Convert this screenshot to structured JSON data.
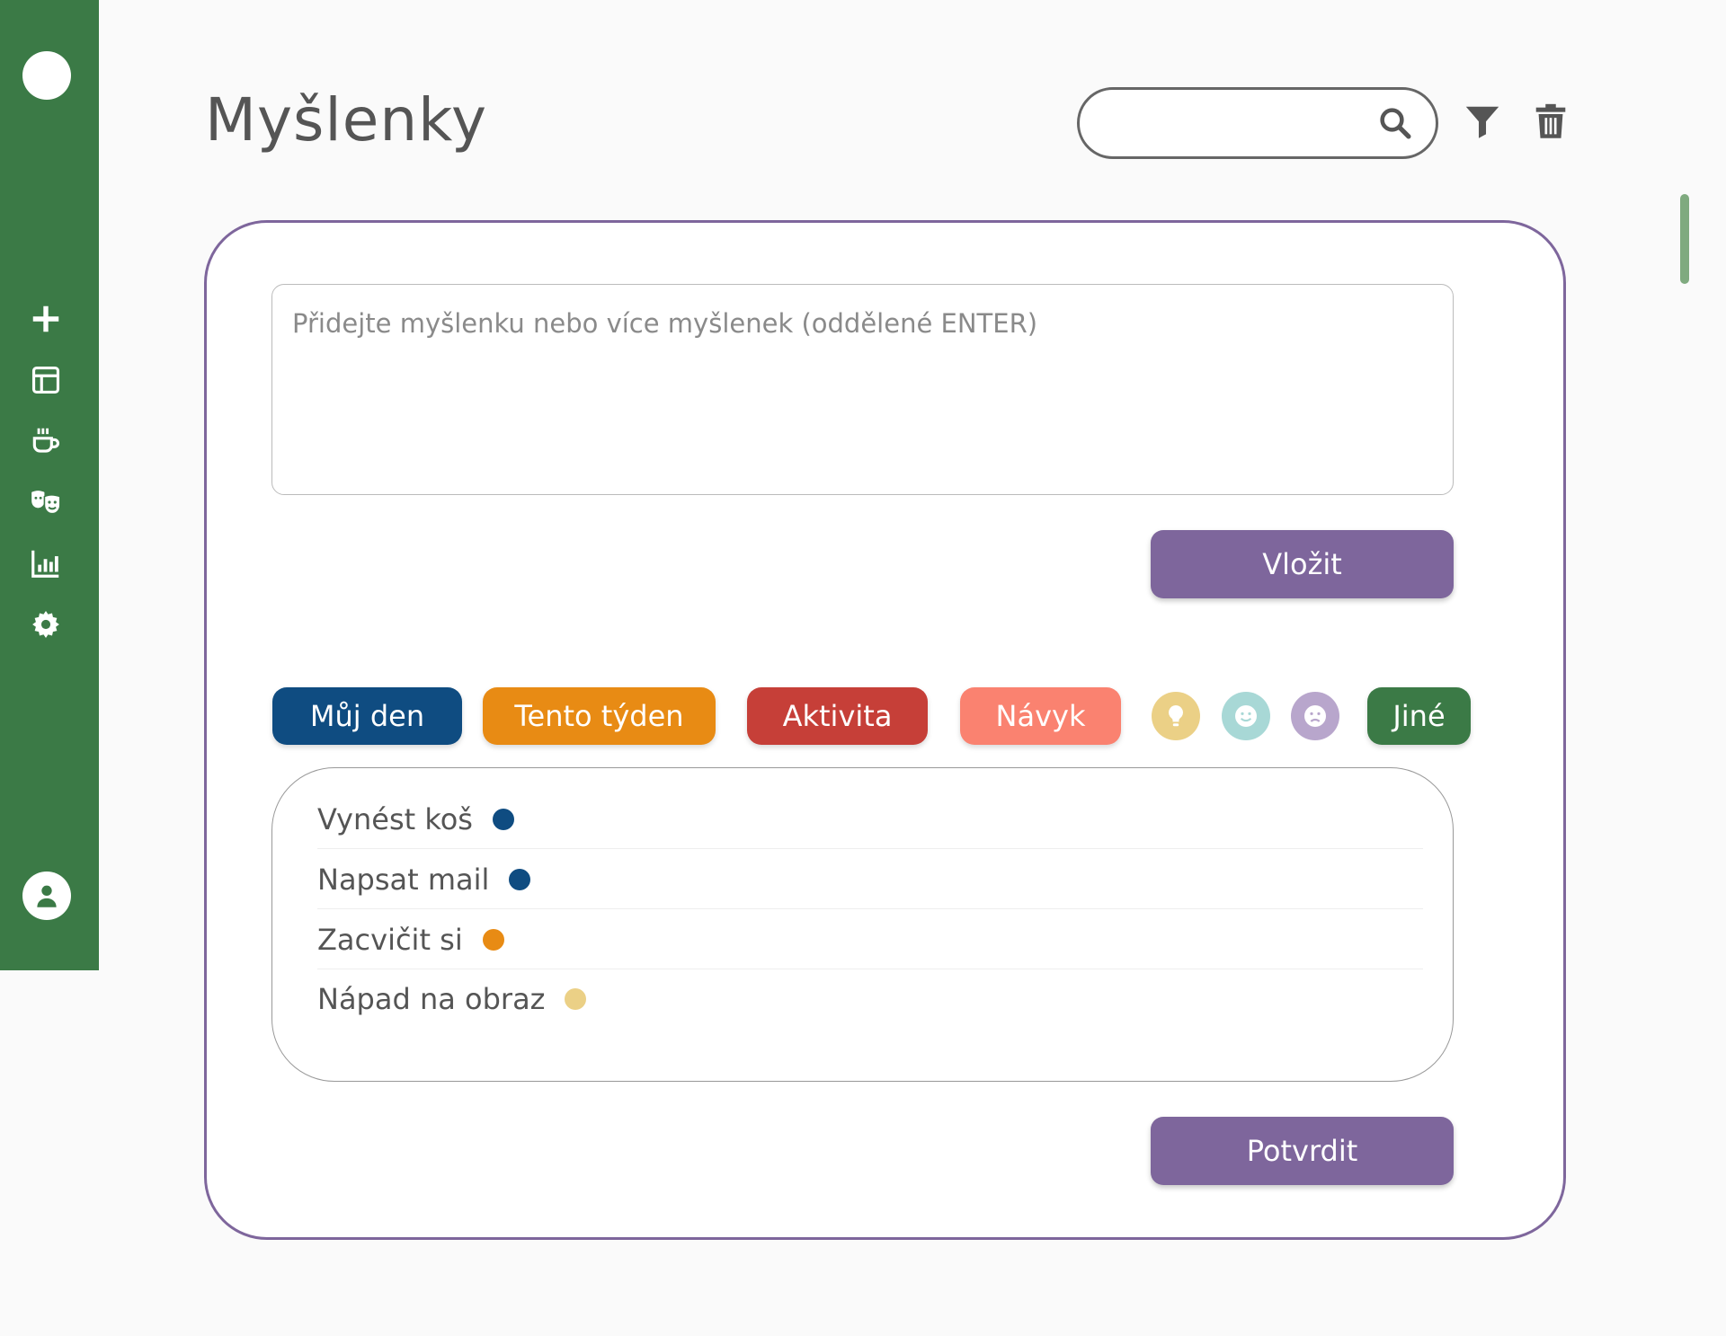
{
  "page": {
    "title": "Myšlenky"
  },
  "search": {
    "placeholder": "",
    "value": "",
    "icon": "search-icon"
  },
  "toolbar": {
    "filter_icon": "filter-icon",
    "delete_icon": "trash-icon"
  },
  "sidebar": {
    "background": "#3b7a46",
    "items": [
      {
        "name": "add",
        "icon": "plus-icon"
      },
      {
        "name": "layout",
        "icon": "layout-icon"
      },
      {
        "name": "coffee",
        "icon": "coffee-cup-icon"
      },
      {
        "name": "masks",
        "icon": "theater-masks-icon"
      },
      {
        "name": "stats",
        "icon": "bar-chart-icon"
      },
      {
        "name": "settings",
        "icon": "gear-icon"
      }
    ],
    "profile_icon": "user-icon"
  },
  "composer": {
    "placeholder": "Přidejte myšlenku nebo více myšlenek (oddělené ENTER)",
    "value": "",
    "submit_label": "Vložit"
  },
  "categories": [
    {
      "label": "Můj den",
      "color": "#0f4c81"
    },
    {
      "label": "Tento týden",
      "color": "#e88b14"
    },
    {
      "label": "Aktivita",
      "color": "#c63f38"
    },
    {
      "label": "Návyk",
      "color": "#fa8270"
    },
    {
      "label": "Jiné",
      "color": "#3b7a46"
    }
  ],
  "moods": [
    {
      "icon": "lightbulb-icon",
      "color": "#ebd086"
    },
    {
      "icon": "smile-icon",
      "color": "#a8d8d6"
    },
    {
      "icon": "sad-face-icon",
      "color": "#b8a6cc"
    }
  ],
  "thoughts": [
    {
      "label": "Vynést koš",
      "color": "#0f4c81"
    },
    {
      "label": "Napsat mail",
      "color": "#0f4c81"
    },
    {
      "label": "Zacvičit si",
      "color": "#e88b14"
    },
    {
      "label": "Nápad na obraz",
      "color": "#ebd086"
    }
  ],
  "confirm": {
    "label": "Potvrdit"
  },
  "theme": {
    "accent": "#7e669c"
  }
}
